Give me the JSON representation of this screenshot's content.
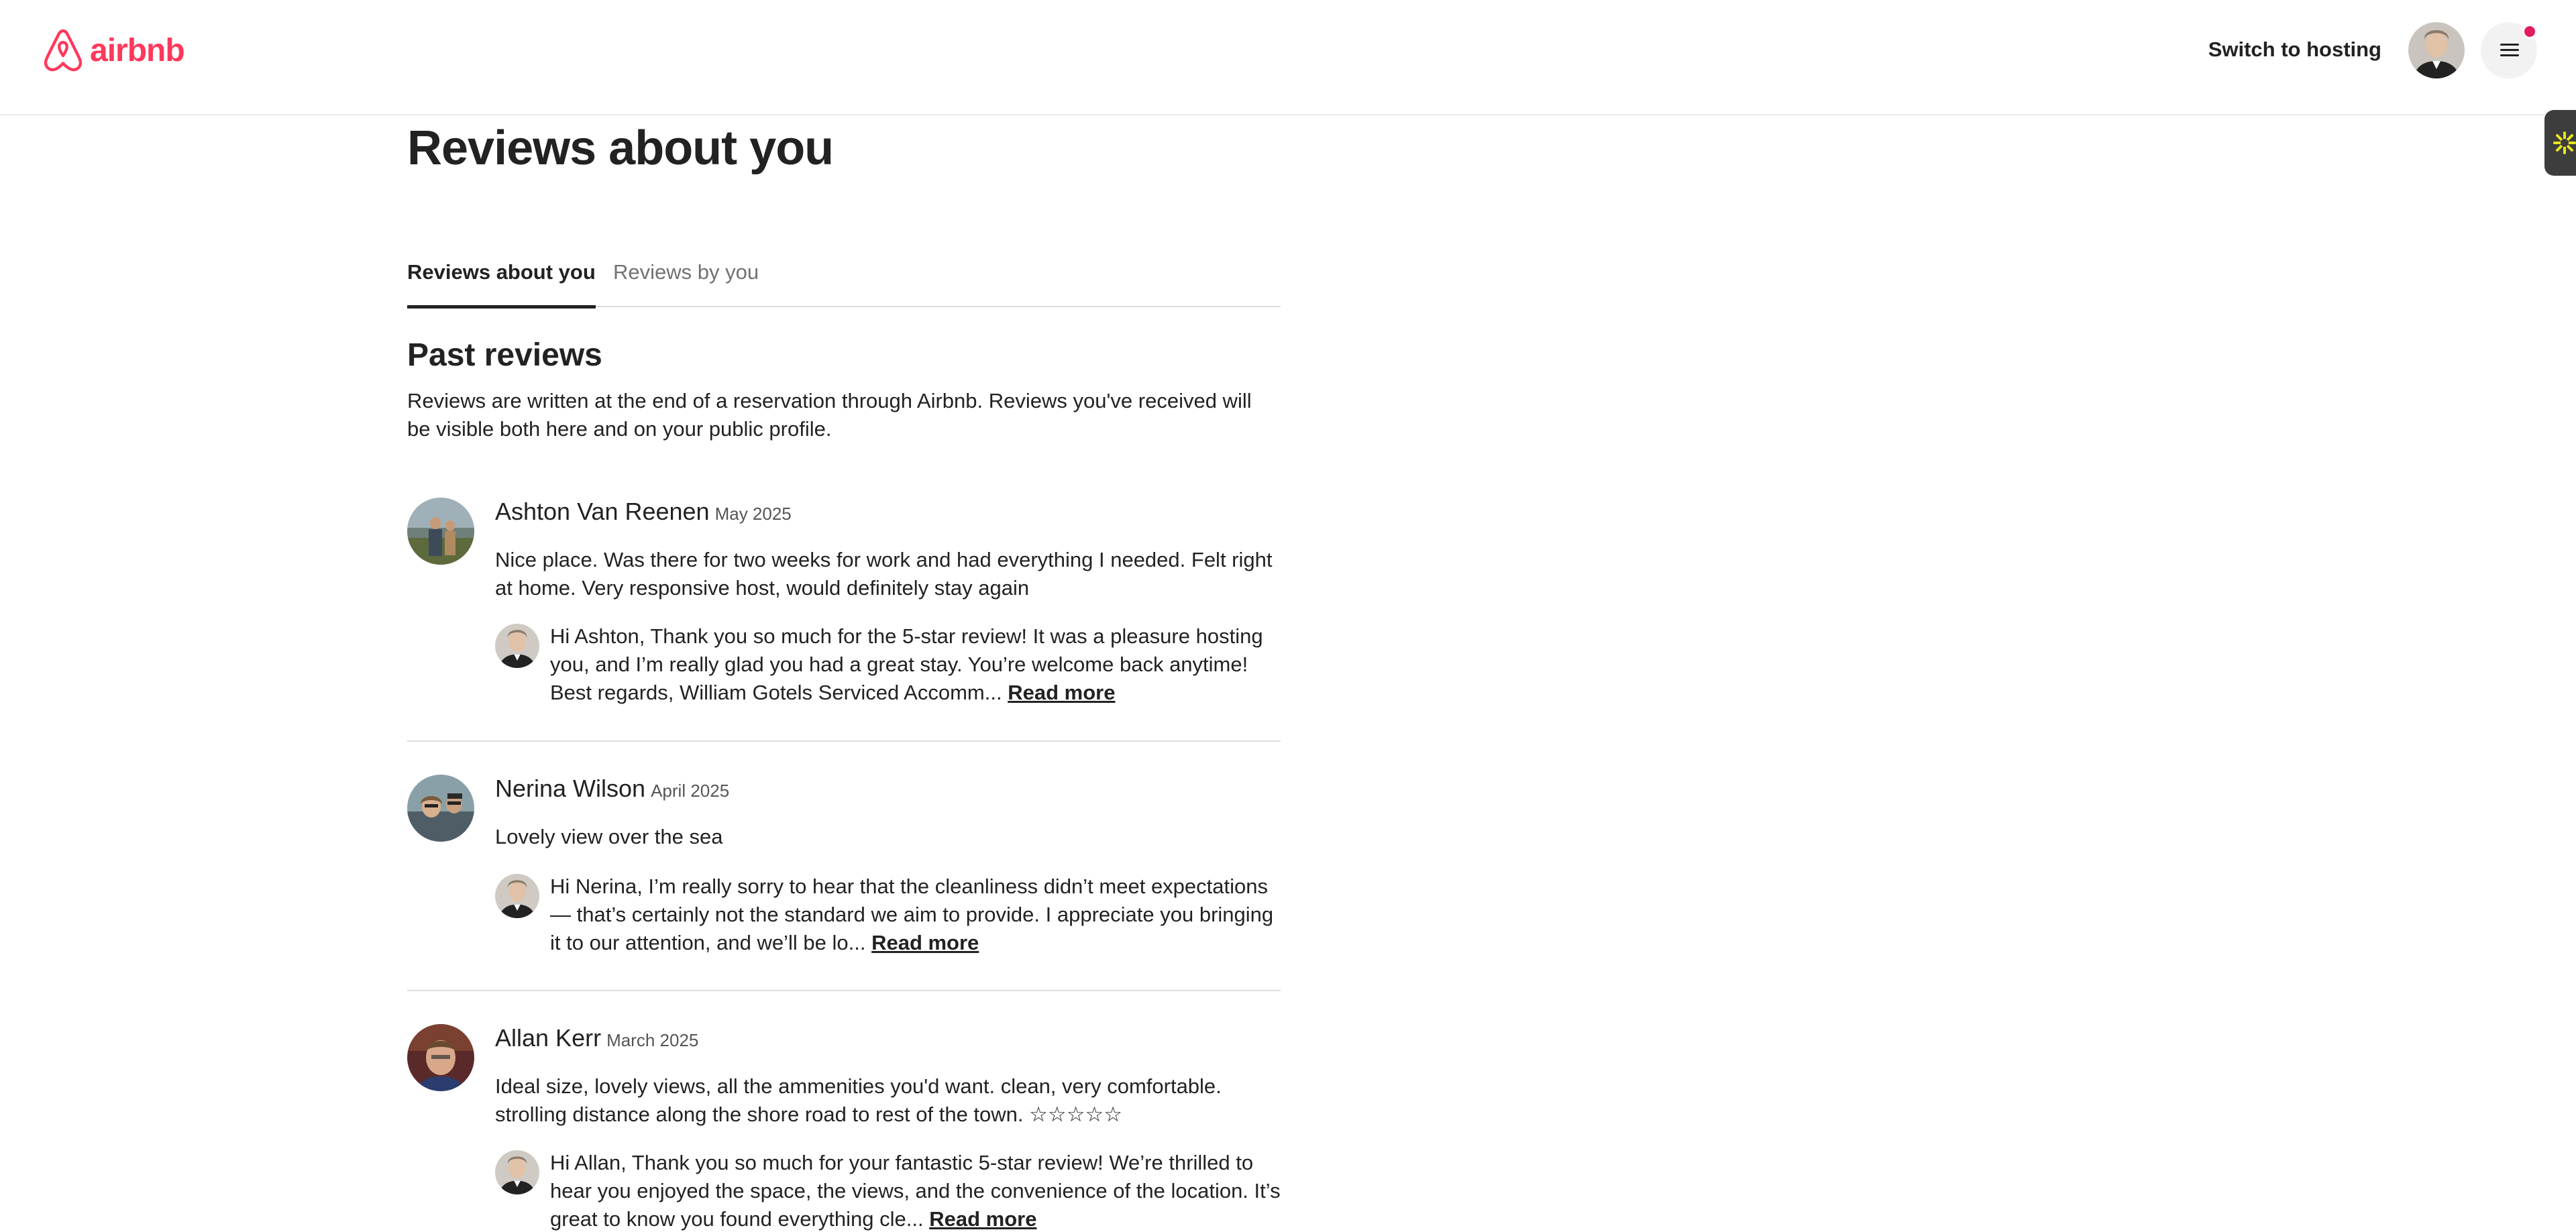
{
  "header": {
    "logo_text": "airbnb",
    "switch_hosting": "Switch to hosting",
    "brand_color": "#ff385c"
  },
  "page": {
    "title": "Reviews about you"
  },
  "tabs": [
    {
      "label": "Reviews about you",
      "active": true
    },
    {
      "label": "Reviews by you",
      "active": false
    }
  ],
  "past_reviews": {
    "title": "Past reviews",
    "description": "Reviews are written at the end of a reservation through Airbnb. Reviews you've received will be visible both here and on your public profile."
  },
  "reviews": [
    {
      "name": "Ashton Van Reenen",
      "date": "May 2025",
      "text": "Nice place. Was there for two weeks for work and had everything I needed. Felt right at home. Very responsive host, would definitely stay again",
      "response": "Hi Ashton, Thank you so much for the 5-star review! It was a pleasure hosting you, and I’m really glad you had a great stay. You’re welcome back anytime! Best regards, William Gotels Serviced Accomm...",
      "read_more": "Read more"
    },
    {
      "name": "Nerina Wilson",
      "date": "April 2025",
      "text": "Lovely view over the sea",
      "response": "Hi Nerina, I’m really sorry to hear that the cleanliness didn’t meet expectations — that’s certainly not the standard we aim to provide. I appreciate you bringing it to our attention, and we’ll be lo...",
      "read_more": "Read more"
    },
    {
      "name": "Allan Kerr",
      "date": "March 2025",
      "text": "Ideal size, lovely views, all the ammenities you'd want. clean, very comfortable. strolling distance along the shore road to rest of the town. ☆☆☆☆☆",
      "response": "Hi Allan, Thank you so much for your fantastic 5-star review! We’re thrilled to hear you enjoyed the space, the views, and the convenience of the location. It’s great to know you found everything cle...",
      "read_more": "Read more"
    }
  ]
}
